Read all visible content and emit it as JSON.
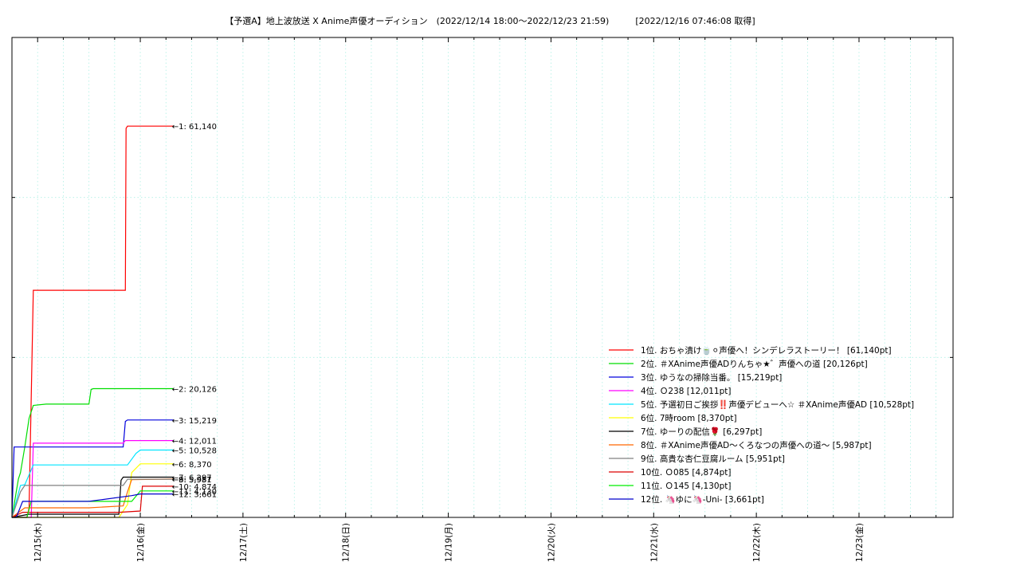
{
  "chart_data": {
    "type": "line",
    "title": "【予選A】地上波放送 X Anime声優オーディション　(2022/12/14 18:00〜2022/12/23 21:59)　　　[2022/12/16 07:46:08 取得]",
    "x_tick_labels": [
      "12/15(木)",
      "12/16(金)",
      "12/17(土)",
      "12/18(日)",
      "12/19(月)",
      "12/20(火)",
      "12/21(水)",
      "12/22(木)",
      "12/23(金)"
    ],
    "xlim": [
      "2022/12/14 18:00",
      "2022/12/23 21:59"
    ],
    "ylim": [
      0,
      75000
    ],
    "grid": true,
    "legend_position": "lower-right",
    "series": [
      {
        "name": "1位. おちゃ漬け🍵⚪声優へ！シンデレラストーリー！ [61,140pt]",
        "end_label": "1: 61,140",
        "color": "#ff0000",
        "points": [
          [
            "12/14 18:00",
            0
          ],
          [
            "12/14 21:30",
            0
          ],
          [
            "12/14 22:00",
            1500
          ],
          [
            "12/14 23:00",
            35500
          ],
          [
            "12/15 01:00",
            35500
          ],
          [
            "12/15 10:00",
            35500
          ],
          [
            "12/15 20:30",
            35500
          ],
          [
            "12/15 20:40",
            60800
          ],
          [
            "12/15 21:00",
            61140
          ],
          [
            "12/16 07:46",
            61140
          ]
        ]
      },
      {
        "name": "2位. ＃XAnime声優ADりんちゃ★゛声優への道 [20,126pt]",
        "end_label": "2: 20,126",
        "color": "#00dd00",
        "points": [
          [
            "12/14 18:00",
            0
          ],
          [
            "12/14 19:30",
            6000
          ],
          [
            "12/14 20:00",
            7000
          ],
          [
            "12/14 21:00",
            11000
          ],
          [
            "12/14 22:00",
            15500
          ],
          [
            "12/14 23:00",
            17500
          ],
          [
            "12/15 02:00",
            17700
          ],
          [
            "12/15 12:00",
            17700
          ],
          [
            "12/15 12:30",
            20000
          ],
          [
            "12/15 13:00",
            20126
          ],
          [
            "12/16 07:46",
            20126
          ]
        ]
      },
      {
        "name": "3位. ゆうなの掃除当番。 [15,219pt]",
        "end_label": "3: 15,219",
        "color": "#0000dd",
        "points": [
          [
            "12/14 18:00",
            0
          ],
          [
            "12/14 18:30",
            11000
          ],
          [
            "12/15 12:00",
            11000
          ],
          [
            "12/15 20:00",
            11000
          ],
          [
            "12/15 20:30",
            15000
          ],
          [
            "12/15 21:00",
            15219
          ],
          [
            "12/16 07:46",
            15219
          ]
        ]
      },
      {
        "name": "4位. Ｏ238 [12,011pt]",
        "end_label": "4: 12,011",
        "color": "#ff00ff",
        "points": [
          [
            "12/14 18:00",
            0
          ],
          [
            "12/14 22:30",
            0
          ],
          [
            "12/14 23:00",
            11600
          ],
          [
            "12/15 20:00",
            11600
          ],
          [
            "12/15 20:30",
            12011
          ],
          [
            "12/16 07:46",
            12011
          ]
        ]
      },
      {
        "name": "5位. 予選初日ご挨拶‼️声優デビューへ☆ ＃XAnime声優AD [10,528pt]",
        "end_label": "5: 10,528",
        "color": "#00e5ff",
        "points": [
          [
            "12/14 18:00",
            0
          ],
          [
            "12/14 20:00",
            5000
          ],
          [
            "12/14 21:00",
            5100
          ],
          [
            "12/14 23:00",
            8200
          ],
          [
            "12/15 12:00",
            8200
          ],
          [
            "12/15 21:00",
            8200
          ],
          [
            "12/15 23:00",
            10000
          ],
          [
            "12/16 00:00",
            10528
          ],
          [
            "12/16 07:46",
            10528
          ]
        ]
      },
      {
        "name": "6位. 7時room [8,370pt]",
        "end_label": "6: 8,370",
        "color": "#ffff00",
        "points": [
          [
            "12/14 18:00",
            0
          ],
          [
            "12/15 19:00",
            0
          ],
          [
            "12/15 21:00",
            2000
          ],
          [
            "12/15 22:00",
            7000
          ],
          [
            "12/16 00:00",
            8370
          ],
          [
            "12/16 07:46",
            8370
          ]
        ]
      },
      {
        "name": "7位. ゆーりの配信🌹 [6,297pt]",
        "end_label": "7: 6,297",
        "color": "#000000",
        "points": [
          [
            "12/14 18:00",
            0
          ],
          [
            "12/14 22:00",
            500
          ],
          [
            "12/15 13:00",
            500
          ],
          [
            "12/15 19:00",
            500
          ],
          [
            "12/15 19:30",
            5800
          ],
          [
            "12/15 20:00",
            6297
          ],
          [
            "12/16 07:46",
            6297
          ]
        ]
      },
      {
        "name": "8位. ＃XAnime声優AD〜くろなつの声優への道〜 [5,987pt]",
        "end_label": "8: 5,987",
        "color": "#ff6600",
        "points": [
          [
            "12/14 18:00",
            0
          ],
          [
            "12/14 21:00",
            1500
          ],
          [
            "12/15 12:00",
            1500
          ],
          [
            "12/15 20:00",
            1800
          ],
          [
            "12/15 21:00",
            4000
          ],
          [
            "12/15 22:00",
            5900
          ],
          [
            "12/16 07:46",
            5987
          ]
        ]
      },
      {
        "name": "9位. 高貴な杏仁豆腐ルーム [5,951pt]",
        "end_label": "9: 5,951",
        "color": "#808080",
        "points": [
          [
            "12/14 18:00",
            0
          ],
          [
            "12/14 20:00",
            4000
          ],
          [
            "12/14 21:00",
            5000
          ],
          [
            "12/15 20:00",
            5000
          ],
          [
            "12/15 21:00",
            5951
          ],
          [
            "12/16 07:46",
            5951
          ]
        ]
      },
      {
        "name": "10位. Ｏ085 [4,874pt]",
        "end_label": "10: 4,874",
        "color": "#dd0000",
        "points": [
          [
            "12/14 18:00",
            0
          ],
          [
            "12/14 20:30",
            800
          ],
          [
            "12/15 19:00",
            800
          ],
          [
            "12/16 00:00",
            1000
          ],
          [
            "12/16 00:30",
            4874
          ],
          [
            "12/16 07:46",
            4874
          ]
        ]
      },
      {
        "name": "11位. Ｏ145 [4,130pt]",
        "end_label": "11: 4,130",
        "color": "#00ee00",
        "points": [
          [
            "12/14 18:00",
            0
          ],
          [
            "12/14 21:30",
            0
          ],
          [
            "12/14 22:30",
            2500
          ],
          [
            "12/15 12:00",
            2500
          ],
          [
            "12/15 22:00",
            2500
          ],
          [
            "12/16 00:00",
            4130
          ],
          [
            "12/16 07:46",
            4130
          ]
        ]
      },
      {
        "name": "12位. 🦄ゆに🦄-Uni- [3,661pt]",
        "end_label": "12: 3,661",
        "color": "#0000cc",
        "points": [
          [
            "12/14 18:00",
            0
          ],
          [
            "12/14 19:00",
            0
          ],
          [
            "12/14 20:30",
            2500
          ],
          [
            "12/15 12:00",
            2500
          ],
          [
            "12/15 22:00",
            3400
          ],
          [
            "12/16 00:00",
            3661
          ],
          [
            "12/16 07:46",
            3661
          ]
        ]
      }
    ]
  }
}
